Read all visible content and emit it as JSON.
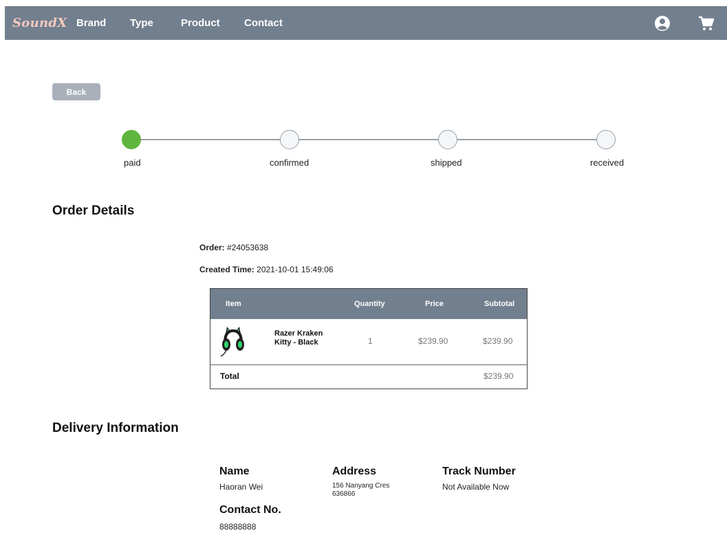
{
  "nav": {
    "logo": "SoundX",
    "links": [
      "Brand",
      "Type",
      "Product",
      "Contact"
    ],
    "icons": [
      "user-icon",
      "cart-icon"
    ]
  },
  "back_label": "Back",
  "progress": {
    "steps": [
      "paid",
      "confirmed",
      "shipped",
      "received"
    ],
    "completed_step": "paid"
  },
  "order_details": {
    "title": "Order Details",
    "order_label": "Order:",
    "order_number": "#24053638",
    "created_label": "Created Time:",
    "created_time": "2021-10-01 15:49:06",
    "table": {
      "headers": [
        "Item",
        "Quantity",
        "Price",
        "Subtotal"
      ],
      "rows": [
        {
          "name": "Razer Kraken Kitty - Black",
          "quantity": "1",
          "price": "$239.90",
          "subtotal": "$239.90"
        }
      ],
      "total_label": "Total",
      "total_value": "$239.90"
    }
  },
  "delivery": {
    "title": "Delivery Information",
    "name_label": "Name",
    "name_value": "Haoran Wei",
    "address_label": "Address",
    "address_line1": "156 Nanyang Cres",
    "address_line2": "636866",
    "track_label": "Track Number",
    "track_value": "Not Available Now",
    "contact_label": "Contact No.",
    "contact_value": "88888888"
  },
  "colors": {
    "navbar": "#727f8e",
    "logo": "#f5c9c0",
    "step_done": "#5fb53d",
    "back_button": "#a9b0ba"
  }
}
